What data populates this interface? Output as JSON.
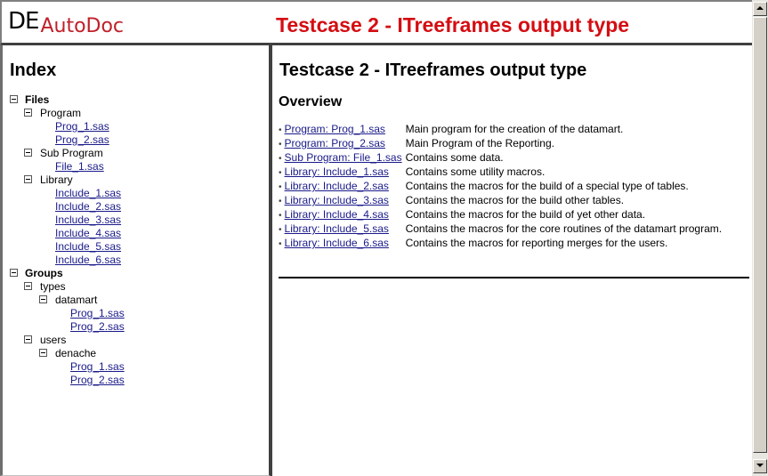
{
  "header": {
    "logo_prefix": "DE",
    "logo_name": "AutoDoc",
    "title": "Testcase 2 - ITreeframes output type",
    "title_color": "#d40d12",
    "logo_color": "#c0202a"
  },
  "index": {
    "title": "Index",
    "tree": {
      "files": {
        "label": "Files",
        "program": {
          "label": "Program",
          "items": [
            "Prog_1.sas",
            "Prog_2.sas"
          ]
        },
        "sub_program": {
          "label": "Sub Program",
          "items": [
            "File_1.sas"
          ]
        },
        "library": {
          "label": "Library",
          "items": [
            "Include_1.sas",
            "Include_2.sas",
            "Include_3.sas",
            "Include_4.sas",
            "Include_5.sas",
            "Include_6.sas"
          ]
        }
      },
      "groups": {
        "label": "Groups",
        "types": {
          "label": "types",
          "datamart": {
            "label": "datamart",
            "items": [
              "Prog_1.sas",
              "Prog_2.sas"
            ]
          }
        },
        "users": {
          "label": "users",
          "denache": {
            "label": "denache",
            "items": [
              "Prog_1.sas",
              "Prog_2.sas"
            ]
          }
        }
      }
    }
  },
  "main": {
    "title": "Testcase 2 - ITreeframes output type",
    "overview_heading": "Overview",
    "bullet": "•",
    "rows": [
      {
        "link": "Program: Prog_1.sas",
        "description": "Main program for the creation of the datamart."
      },
      {
        "link": "Program: Prog_2.sas",
        "description": "Main Program of the Reporting."
      },
      {
        "link": "Sub Program: File_1.sas",
        "description": "Contains some data."
      },
      {
        "link": "Library: Include_1.sas",
        "description": "Contains some utility macros."
      },
      {
        "link": "Library: Include_2.sas",
        "description": "Contains the macros for the build of a special type of tables."
      },
      {
        "link": "Library: Include_3.sas",
        "description": "Contains the macros for the build other tables."
      },
      {
        "link": "Library: Include_4.sas",
        "description": "Contains the macros for the build of yet other data."
      },
      {
        "link": "Library: Include_5.sas",
        "description": "Contains the macros for the core routines of the datamart program."
      },
      {
        "link": "Library: Include_6.sas",
        "description": "Contains the macros for reporting merges for the users."
      }
    ]
  },
  "scrollbar": {
    "up_icon": "arrow-up",
    "down_icon": "arrow-down"
  }
}
